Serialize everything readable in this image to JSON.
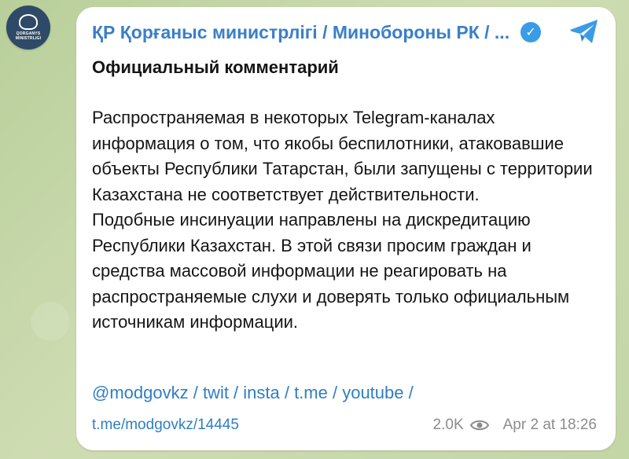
{
  "channel": {
    "avatar_caption_line1": "QORGANYS",
    "avatar_caption_line2": "MINISTRLIGI",
    "name": "ҚР Қорғаныс министрлігі / Минобороны РК / ...",
    "verified_glyph": "✓"
  },
  "post": {
    "heading": "Официальный комментарий",
    "paragraph1": "Распространяемая в некоторых Telegram-каналах информация о том, что якобы беспилотники, атаковавшие объекты Республики Татарстан, были запущены с территории Казахстана не соответствует действительности.",
    "paragraph2": "Подобные инсинуации направлены на дискредитацию Республики Казахстан. В этой связи просим граждан и средства массовой информации не реагировать на распространяемые слухи и доверять только официальным источникам информации.",
    "links_line": "@modgovkz / twit / insta / t.me / youtube /",
    "post_link": "t.me/modgovkz/14445",
    "views": "2.0K",
    "date": "Apr 2 at 18:26"
  },
  "colors": {
    "link": "#2f7ec4",
    "accent": "#3a9be6",
    "meta": "#8c8c8c"
  },
  "icons": [
    "verified-badge-icon",
    "telegram-share-icon",
    "eye-icon"
  ]
}
